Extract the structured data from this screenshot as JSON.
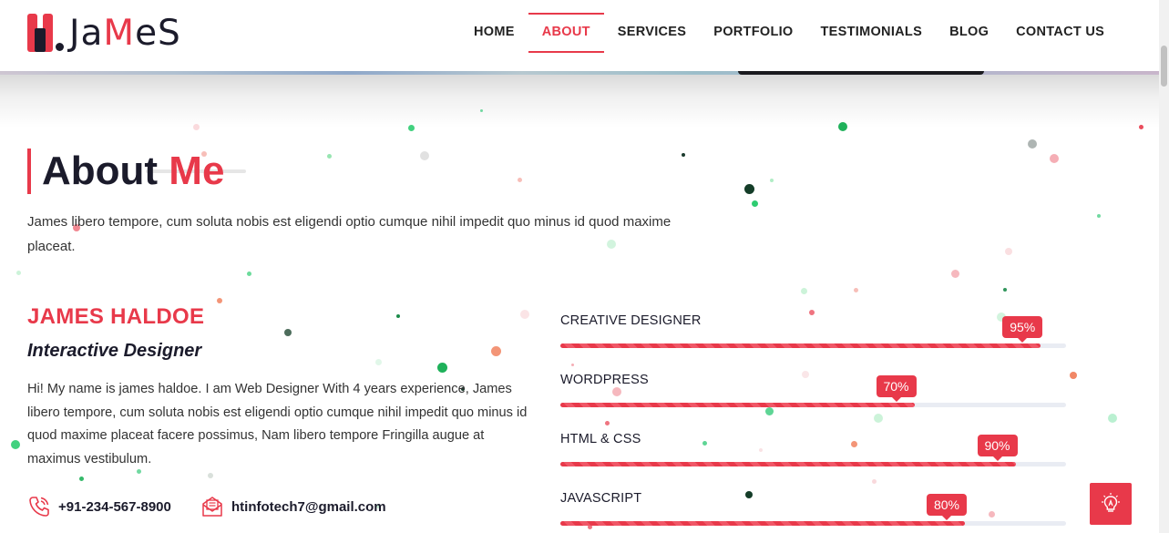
{
  "brand": {
    "logo_text_dark_1": "Ja",
    "logo_text_red": "M",
    "logo_text_dark_2": "eS"
  },
  "nav": {
    "items": [
      {
        "label": "HOME"
      },
      {
        "label": "ABOUT"
      },
      {
        "label": "SERVICES"
      },
      {
        "label": "PORTFOLIO"
      },
      {
        "label": "TESTIMONIALS"
      },
      {
        "label": "BLOG"
      },
      {
        "label": "CONTACT US"
      }
    ],
    "active": "ABOUT"
  },
  "about": {
    "title_main": "About ",
    "title_accent": "Me",
    "intro": "James libero tempore, cum soluta nobis est eligendi optio cumque nihil impedit quo minus id quod maxime placeat.",
    "name": "JAMES HALDOE",
    "role": "Interactive Designer",
    "bio": "Hi! My name is james haldoe. I am Web Designer With 4 years experience, James libero tempore, cum soluta nobis est eligendi optio cumque nihil impedit quo minus id quod maxime placeat facere possimus, Nam libero tempore Fringilla augue at maximus vestibulum.",
    "phone": "+91-234-567-8900",
    "email": "htinfotech7@gmail.com"
  },
  "skills": [
    {
      "label": "CREATIVE DESIGNER",
      "percent": 95,
      "percent_text": "95%"
    },
    {
      "label": "WORDPRESS",
      "percent": 70,
      "percent_text": "70%"
    },
    {
      "label": "HTML & CSS",
      "percent": 90,
      "percent_text": "90%"
    },
    {
      "label": "JAVASCRIPT",
      "percent": 80,
      "percent_text": "80%"
    }
  ],
  "icons": {
    "phone": "phone-icon",
    "email": "envelope-icon",
    "fab": "lightbulb-icon"
  },
  "colors": {
    "accent": "#e8394a",
    "dark": "#1b1b2b",
    "track": "#e9ecf3"
  }
}
